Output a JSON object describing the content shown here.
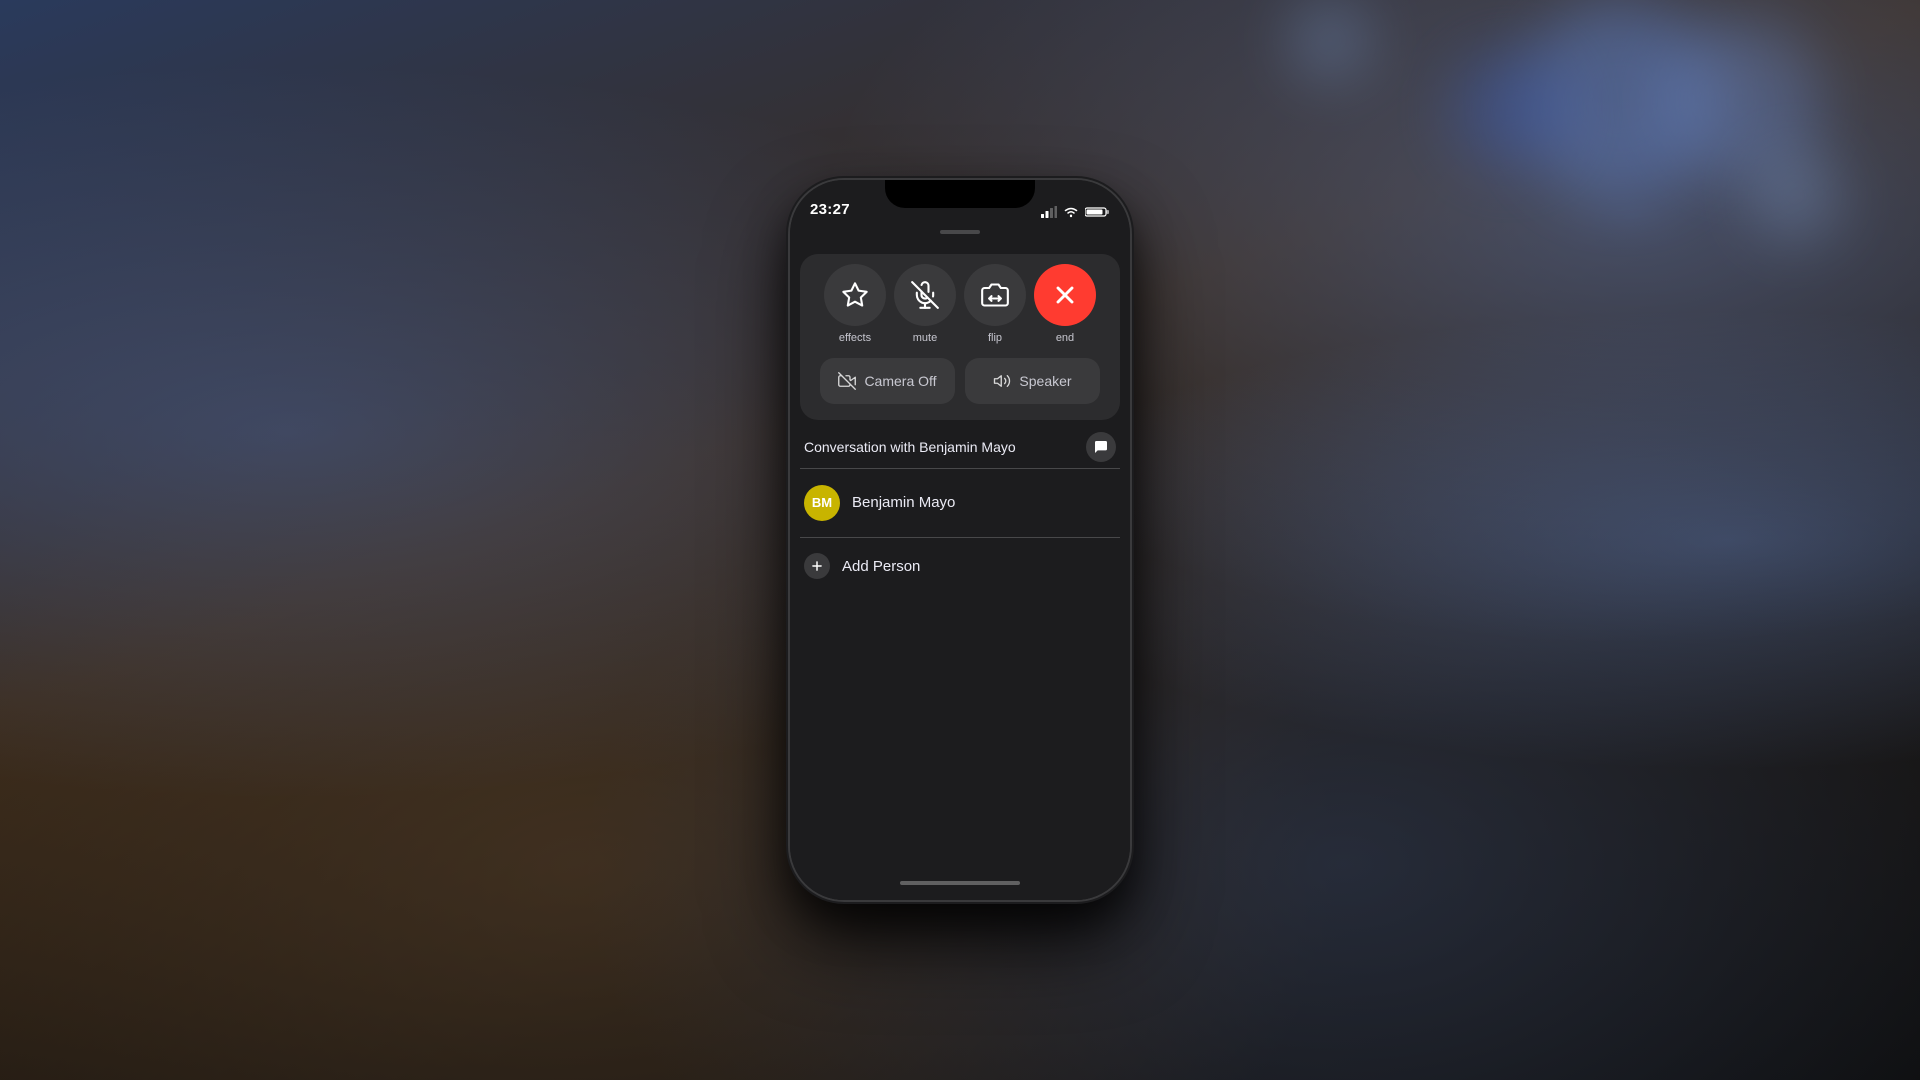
{
  "background": {
    "description": "Blurred room with bokeh lights and wooden surface"
  },
  "phone": {
    "status_bar": {
      "time": "23:27",
      "location_icon": true,
      "signal_bars": 2,
      "wifi_icon": true,
      "battery_icon": true
    },
    "call_controls": {
      "buttons": [
        {
          "id": "effects",
          "label": "effects",
          "icon": "star-icon",
          "color": "dark"
        },
        {
          "id": "mute",
          "label": "mute",
          "icon": "mic-off-icon",
          "color": "dark"
        },
        {
          "id": "flip",
          "label": "flip",
          "icon": "camera-rotate-icon",
          "color": "dark"
        },
        {
          "id": "end",
          "label": "end",
          "icon": "x-icon",
          "color": "red"
        }
      ],
      "wide_buttons": [
        {
          "id": "camera-off",
          "label": "Camera Off",
          "icon": "video-off-icon"
        },
        {
          "id": "speaker",
          "label": "Speaker",
          "icon": "speaker-icon"
        }
      ]
    },
    "conversation": {
      "title": "Conversation with Benjamin Mayo",
      "message_button_label": "message",
      "contacts": [
        {
          "id": "benjamin-mayo",
          "initials": "BM",
          "name": "Benjamin Mayo",
          "avatar_color": "#c8b400"
        }
      ],
      "add_person_label": "Add Person"
    },
    "home_indicator": true
  }
}
